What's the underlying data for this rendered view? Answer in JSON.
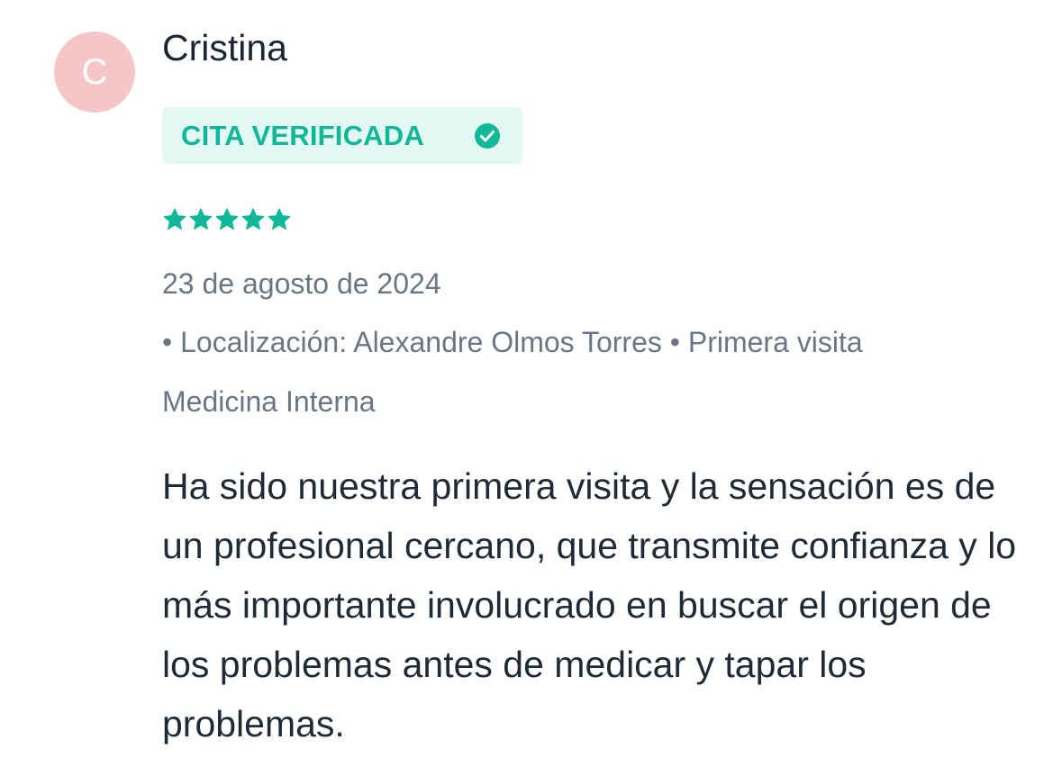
{
  "review": {
    "avatar_initial": "C",
    "author": "Cristina",
    "badge_label": "CITA VERIFICADA",
    "rating": 5,
    "rating_max": 5,
    "date": "23 de agosto de 2024",
    "meta": "• Localización: Alexandre Olmos Torres • Primera visita",
    "specialty": "Medicina Interna",
    "text": "Ha sido nuestra primera visita y la sensación es de un profesional cercano, que transmite confianza y lo más importante involucrado en buscar el origen de los problemas antes de medicar y tapar los problemas."
  },
  "icons": {
    "badge_icon": "check-circle-icon",
    "rating_icon": "star-icon"
  },
  "colors": {
    "accent": "#10b897",
    "badge_bg": "#e3f7f3",
    "avatar_bg": "#f5c7c4",
    "muted_text": "#6b7685",
    "main_text": "#1f2a37"
  }
}
